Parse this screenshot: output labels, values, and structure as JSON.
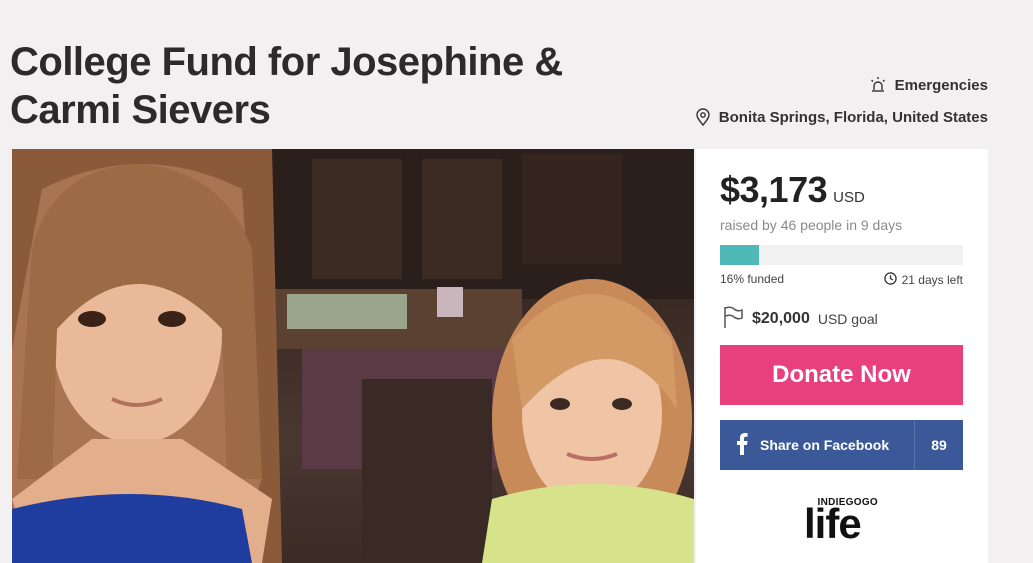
{
  "campaign": {
    "title": "College Fund for Josephine & Carmi Sievers",
    "category": "Emergencies",
    "location": "Bonita Springs, Florida, United States"
  },
  "funding": {
    "amount": "$3,173",
    "currency": "USD",
    "raised_text": "raised by 46 people in 9 days",
    "progress_percent": 16,
    "funded_text": "16% funded",
    "days_left": "21 days left",
    "goal_amount": "$20,000",
    "goal_suffix": "USD goal"
  },
  "actions": {
    "donate_label": "Donate Now",
    "share_label": "Share on Facebook",
    "share_count": "89"
  },
  "branding": {
    "logo_small": "INDIEGOGO",
    "logo_big": "life"
  },
  "colors": {
    "donate": "#e8407c",
    "facebook": "#3b5998",
    "progress": "#4fb8b9"
  },
  "icons": [
    "alarm-icon",
    "map-pin-icon",
    "clock-icon",
    "flag-icon",
    "facebook-icon"
  ]
}
